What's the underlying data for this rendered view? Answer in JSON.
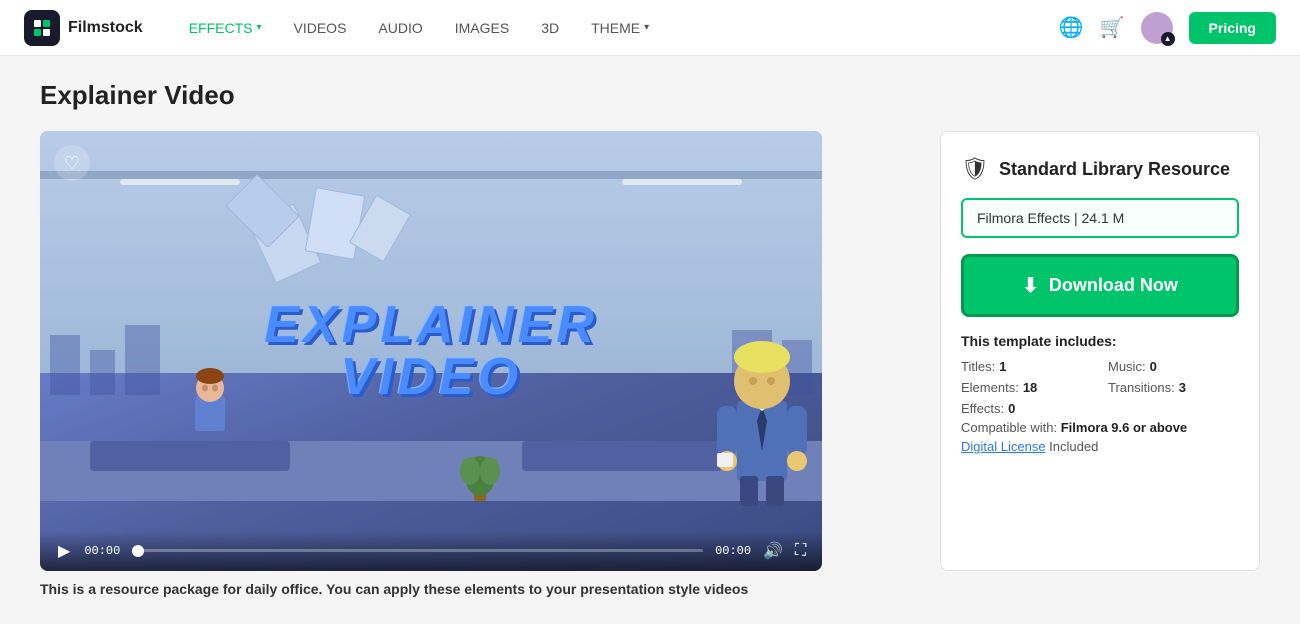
{
  "brand": {
    "logo_text": "Filmstock",
    "logo_icon": "🎬"
  },
  "nav": {
    "items": [
      {
        "id": "effects",
        "label": "EFFECTS",
        "has_chevron": true,
        "active": true
      },
      {
        "id": "videos",
        "label": "VIDEOS",
        "has_chevron": false,
        "active": false
      },
      {
        "id": "audio",
        "label": "AUDIO",
        "has_chevron": false,
        "active": false
      },
      {
        "id": "images",
        "label": "IMAGES",
        "has_chevron": false,
        "active": false
      },
      {
        "id": "3d",
        "label": "3D",
        "has_chevron": false,
        "active": false
      },
      {
        "id": "theme",
        "label": "THEME",
        "has_chevron": true,
        "active": false
      }
    ],
    "pricing_label": "Pricing"
  },
  "page": {
    "title": "Explainer Video"
  },
  "video": {
    "overlay_line1": "EXPLAINER",
    "overlay_line2": "VIDEO",
    "time_current": "00:00",
    "time_total": "00:00"
  },
  "resource": {
    "shield_icon": "🛡",
    "title": "Standard Library Resource",
    "file_info": "Filmora Effects | 24.1 M",
    "download_label": "Download Now",
    "template_includes_label": "This template includes:",
    "titles_label": "Titles:",
    "titles_val": "1",
    "music_label": "Music:",
    "music_val": "0",
    "elements_label": "Elements:",
    "elements_val": "18",
    "transitions_label": "Transitions:",
    "transitions_val": "3",
    "effects_label": "Effects:",
    "effects_val": "0",
    "compat_label": "Compatible with:",
    "compat_val": "Filmora 9.6 or above",
    "license_link": "Digital License",
    "license_suffix": "Included"
  },
  "description": {
    "text": "This is a resource package for daily office. You can apply these elements to your presentation style videos"
  }
}
